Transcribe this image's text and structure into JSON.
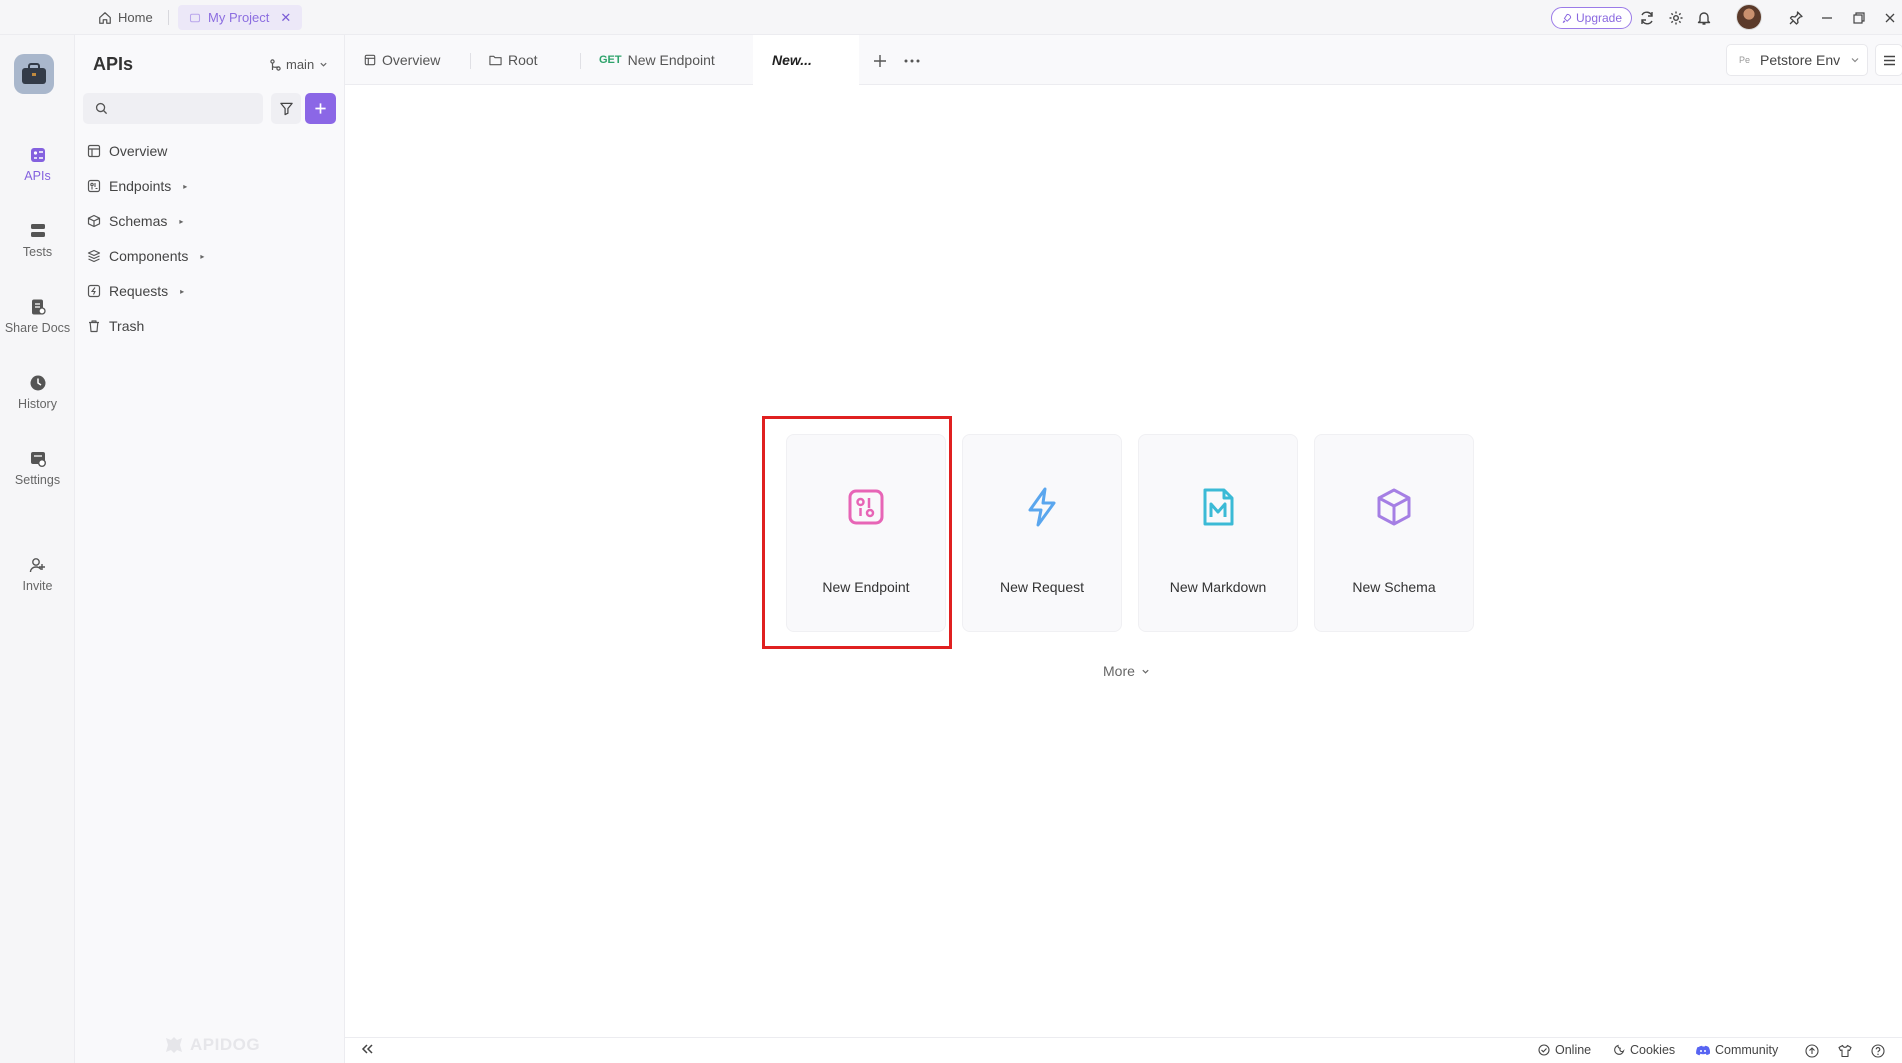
{
  "topbar": {
    "home_label": "Home",
    "project_tab_label": "My Project",
    "upgrade_label": "Upgrade"
  },
  "rail": {
    "items": [
      {
        "label": "APIs",
        "icon": "apis-icon"
      },
      {
        "label": "Tests",
        "icon": "tests-icon"
      },
      {
        "label": "Share Docs",
        "icon": "share-docs-icon"
      },
      {
        "label": "History",
        "icon": "history-icon"
      },
      {
        "label": "Settings",
        "icon": "settings-icon"
      },
      {
        "label": "Invite",
        "icon": "invite-icon"
      }
    ]
  },
  "sidebar": {
    "title": "APIs",
    "branch": "main",
    "search_placeholder": "",
    "tree": [
      {
        "label": "Overview",
        "icon": "overview-icon"
      },
      {
        "label": "Endpoints",
        "icon": "endpoints-icon"
      },
      {
        "label": "Schemas",
        "icon": "schemas-icon"
      },
      {
        "label": "Components",
        "icon": "components-icon"
      },
      {
        "label": "Requests",
        "icon": "requests-icon"
      },
      {
        "label": "Trash",
        "icon": "trash-icon"
      }
    ],
    "watermark": "APIDOG"
  },
  "tabs": [
    {
      "label": "Overview",
      "icon": "overview-icon"
    },
    {
      "label": "Root",
      "icon": "folder-icon"
    },
    {
      "method": "GET",
      "label": "New Endpoint"
    },
    {
      "label": "New..."
    }
  ],
  "environment": {
    "badge": "Pe",
    "label": "Petstore Env"
  },
  "main": {
    "cards": [
      {
        "label": "New Endpoint",
        "icon": "endpoint-icon",
        "color": "#e765b6"
      },
      {
        "label": "New Request",
        "icon": "lightning-icon",
        "color": "#5aa6ee"
      },
      {
        "label": "New Markdown",
        "icon": "markdown-icon",
        "color": "#3bbad6"
      },
      {
        "label": "New Schema",
        "icon": "cube-icon",
        "color": "#a57fe4"
      }
    ],
    "more_label": "More"
  },
  "bottombar": {
    "online_label": "Online",
    "cookies_label": "Cookies",
    "community_label": "Community"
  },
  "colors": {
    "accent": "#8b67e6",
    "highlight": "#e02020",
    "get_method": "#2ea36b"
  }
}
